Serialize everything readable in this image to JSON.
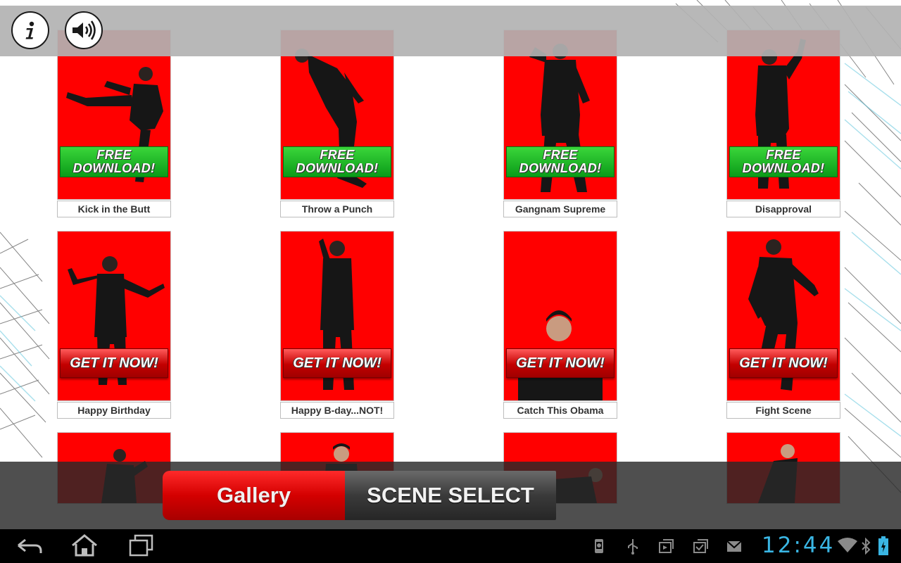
{
  "header": {
    "info_icon": "info-icon",
    "sound_icon": "speaker-icon"
  },
  "tiles": [
    {
      "caption": "Kick in the Butt",
      "badge_line1": "FREE",
      "badge_line2": "DOWNLOAD!",
      "badge_type": "free"
    },
    {
      "caption": "Throw a Punch",
      "badge_line1": "FREE",
      "badge_line2": "DOWNLOAD!",
      "badge_type": "free"
    },
    {
      "caption": "Gangnam Supreme",
      "badge_line1": "FREE",
      "badge_line2": "DOWNLOAD!",
      "badge_type": "free"
    },
    {
      "caption": "Disapproval",
      "badge_line1": "FREE",
      "badge_line2": "DOWNLOAD!",
      "badge_type": "free"
    },
    {
      "caption": "Happy Birthday",
      "badge_line1": "GET IT NOW!",
      "badge_type": "get"
    },
    {
      "caption": "Happy B-day...NOT!",
      "badge_line1": "GET IT NOW!",
      "badge_type": "get"
    },
    {
      "caption": "Catch This Obama",
      "badge_line1": "GET IT NOW!",
      "badge_type": "get"
    },
    {
      "caption": "Fight Scene",
      "badge_line1": "GET IT NOW!",
      "badge_type": "get"
    }
  ],
  "bottom_tabs": {
    "gallery": "Gallery",
    "scene_select": "SCENE SELECT",
    "active": "Gallery"
  },
  "system_bar": {
    "clock": "12:44",
    "accent_color": "#3ab6e4",
    "nav_icons": [
      "back-icon",
      "home-icon",
      "recent-apps-icon"
    ],
    "status_icons": [
      "android-debug-icon",
      "usb-icon",
      "download-icon",
      "update-icon",
      "email-icon",
      "wifi-icon",
      "bluetooth-icon",
      "battery-icon"
    ]
  },
  "colors": {
    "tile_red": "#ff0000",
    "free_green": "#0a9b18",
    "tab_active_red": "#d40000"
  }
}
